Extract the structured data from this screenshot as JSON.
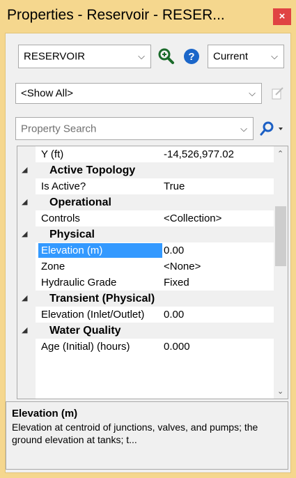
{
  "window": {
    "title": "Properties - Reservoir - RESER...",
    "close_label": "×"
  },
  "toolbar": {
    "element_select": "RESERVOIR",
    "scenario_select": "Current",
    "filter_select": "<Show All>",
    "search_placeholder": "Property Search"
  },
  "grid": {
    "rows": [
      {
        "type": "prop",
        "name": "Y (ft)",
        "value": "-14,526,977.02"
      },
      {
        "type": "cat",
        "name": "Active Topology"
      },
      {
        "type": "prop",
        "name": "Is Active?",
        "value": "True"
      },
      {
        "type": "cat",
        "name": "Operational"
      },
      {
        "type": "prop",
        "name": "Controls",
        "value": "<Collection>"
      },
      {
        "type": "cat",
        "name": "Physical"
      },
      {
        "type": "prop",
        "name": "Elevation (m)",
        "value": "0.00",
        "selected": true
      },
      {
        "type": "prop",
        "name": "Zone",
        "value": "<None>"
      },
      {
        "type": "prop",
        "name": "Hydraulic Grade",
        "value": "Fixed"
      },
      {
        "type": "cat",
        "name": "Transient (Physical)"
      },
      {
        "type": "prop",
        "name": "Elevation (Inlet/Outlet)",
        "value": "0.00"
      },
      {
        "type": "cat",
        "name": "Water Quality"
      },
      {
        "type": "prop",
        "name": "Age (Initial) (hours)",
        "value": "0.000"
      }
    ]
  },
  "description": {
    "title": "Elevation (m)",
    "text": "Elevation at centroid of junctions, valves, and pumps; the ground elevation at tanks; t..."
  },
  "colors": {
    "frame": "#f5d78e",
    "selection": "#3399ff",
    "close": "#e04343"
  }
}
